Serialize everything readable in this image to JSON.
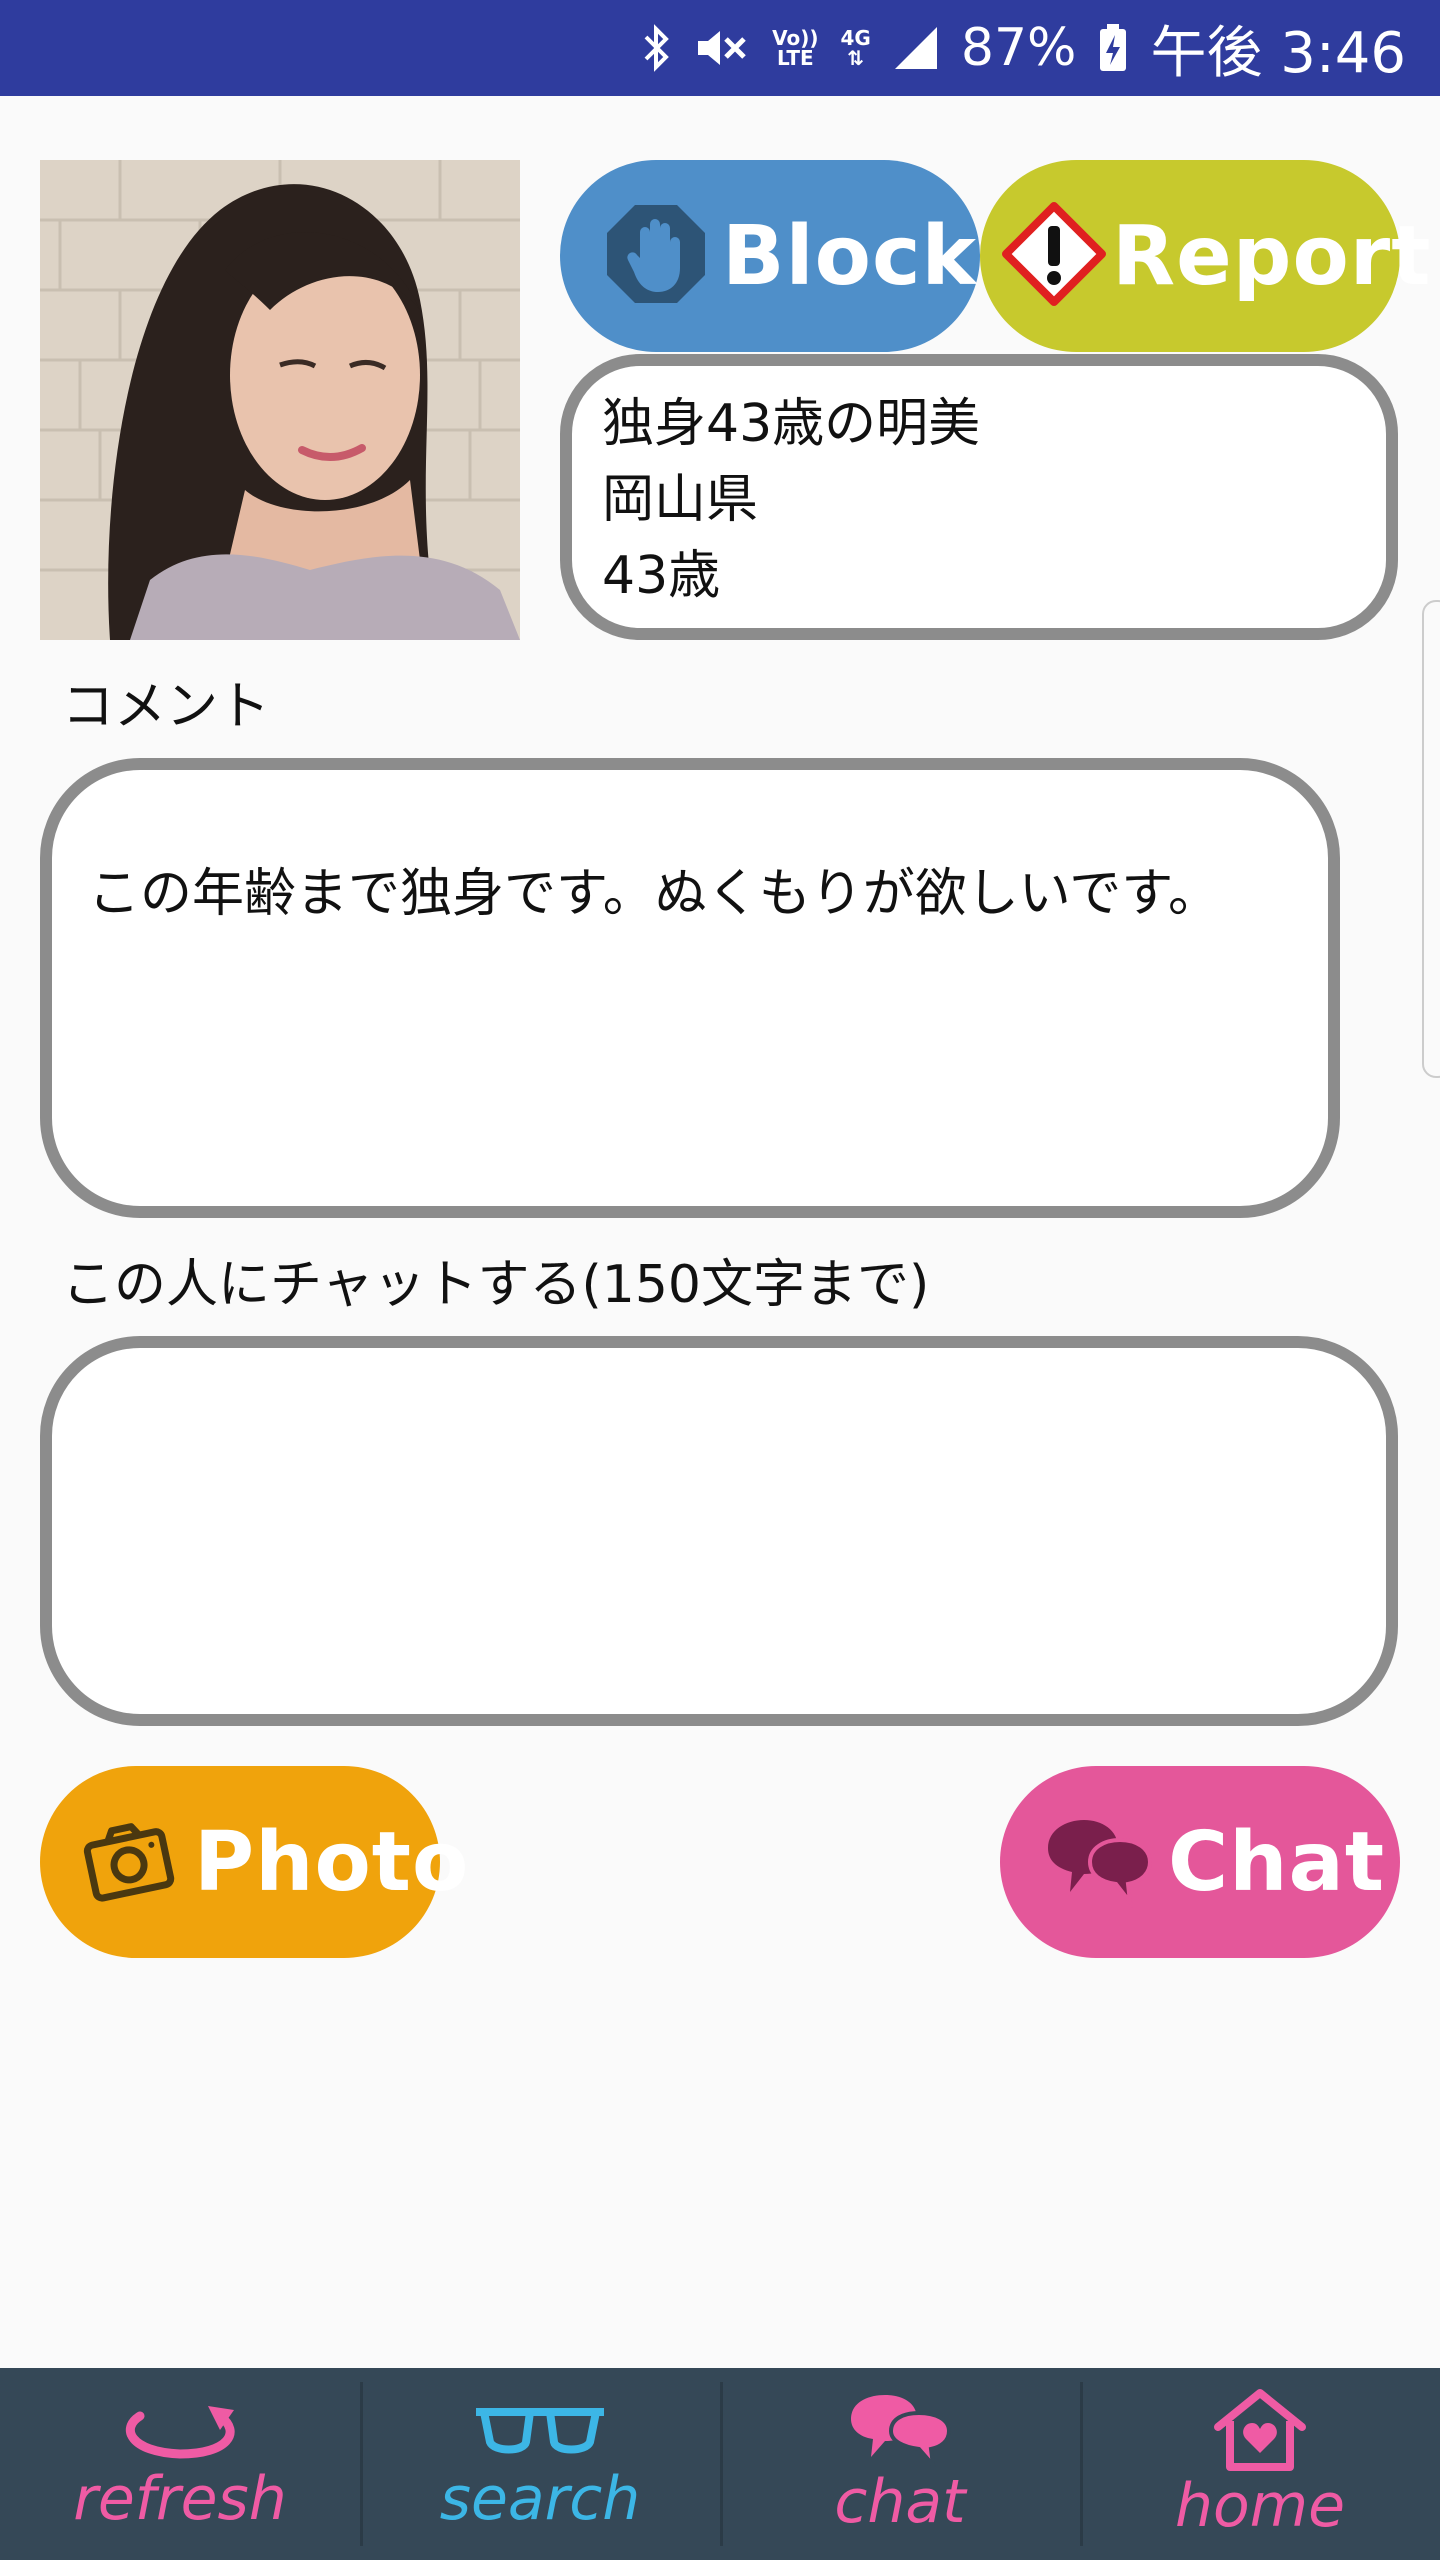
{
  "status_bar": {
    "volte_top": "Vo))",
    "volte_bottom": "LTE",
    "network": "4G",
    "battery": "87%",
    "time": "午後 3:46"
  },
  "profile": {
    "block_label": "Block",
    "report_label": "Report",
    "name": "独身43歳の明美",
    "prefecture": "岡山県",
    "age": "43歳"
  },
  "comment": {
    "label": "コメント",
    "text": "この年齢まで独身です。ぬくもりが欲しいです。"
  },
  "chat_form": {
    "label": "この人にチャットする(150文字まで)",
    "value": "",
    "photo_label": "Photo",
    "chat_label": "Chat"
  },
  "bottom_nav": {
    "items": [
      {
        "label": "refresh",
        "icon": "refresh-icon"
      },
      {
        "label": "search",
        "icon": "glasses-icon"
      },
      {
        "label": "chat",
        "icon": "chat-bubbles-icon"
      },
      {
        "label": "home",
        "icon": "home-heart-icon"
      }
    ]
  },
  "colors": {
    "status_bar": "#2f3c9e",
    "block": "#4f8fc9",
    "report": "#c7c92d",
    "photo": "#f0a30c",
    "chat": "#e4579a",
    "nav_bg": "#354857",
    "nav_pink": "#ef5ba4",
    "nav_blue": "#3cb6e6"
  }
}
